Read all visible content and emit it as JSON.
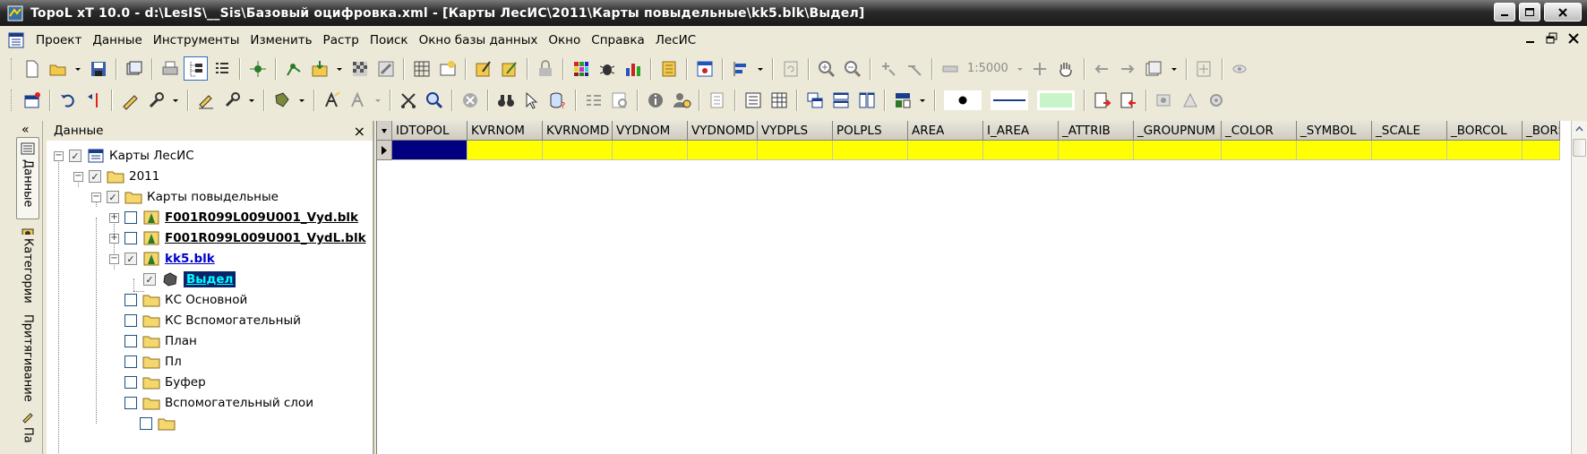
{
  "window": {
    "title": "TopoL xT 10.0 - d:\\LesIS\\__Sis\\Базовый оцифровка.xml - [Карты ЛесИС\\2011\\Карты повыдельные\\kk5.blk\\Выдел]"
  },
  "menu": {
    "items": [
      "Проект",
      "Данные",
      "Инструменты",
      "Изменить",
      "Растр",
      "Поиск",
      "Окно базы данных",
      "Окно",
      "Справка",
      "ЛесИС"
    ]
  },
  "toolbar": {
    "scale": "1:5000"
  },
  "side_tabs": [
    "Данные",
    "Категории",
    "Притягивание",
    "Па"
  ],
  "panel": {
    "title": "Данные",
    "close": "×",
    "collapse": "«"
  },
  "tree": {
    "nodes": [
      {
        "label": "Карты ЛесИС",
        "type": "root"
      },
      {
        "label": "2011",
        "type": "folder"
      },
      {
        "label": "Карты повыдельные",
        "type": "folder"
      },
      {
        "label": "F001R099L009U001_Vyd.blk",
        "type": "file"
      },
      {
        "label": "F001R099L009U001_VydL.blk",
        "type": "file"
      },
      {
        "label": "kk5.blk",
        "type": "file-active"
      },
      {
        "label": "Выдел",
        "type": "layer-selected"
      },
      {
        "label": "КС Основной",
        "type": "folder"
      },
      {
        "label": "КС Вспомогательный",
        "type": "folder"
      },
      {
        "label": "План",
        "type": "folder"
      },
      {
        "label": "Пл",
        "type": "folder"
      },
      {
        "label": "Буфер",
        "type": "folder"
      },
      {
        "label": "Вспомогательный слои",
        "type": "folder"
      }
    ]
  },
  "grid": {
    "columns": [
      "IDTOPOL",
      "KVRNOM",
      "KVRNOMD",
      "VYDNOM",
      "VYDNOMD",
      "VYDPLS",
      "POLPLS",
      "AREA",
      "I_AREA",
      "_ATTRIB",
      "_GROUPNUM",
      "_COLOR",
      "_SYMBOL",
      "_SCALE",
      "_BORCOL",
      "_BORS"
    ],
    "row_highlight_color": "#ffff00",
    "current_cell_color": "#000080"
  }
}
